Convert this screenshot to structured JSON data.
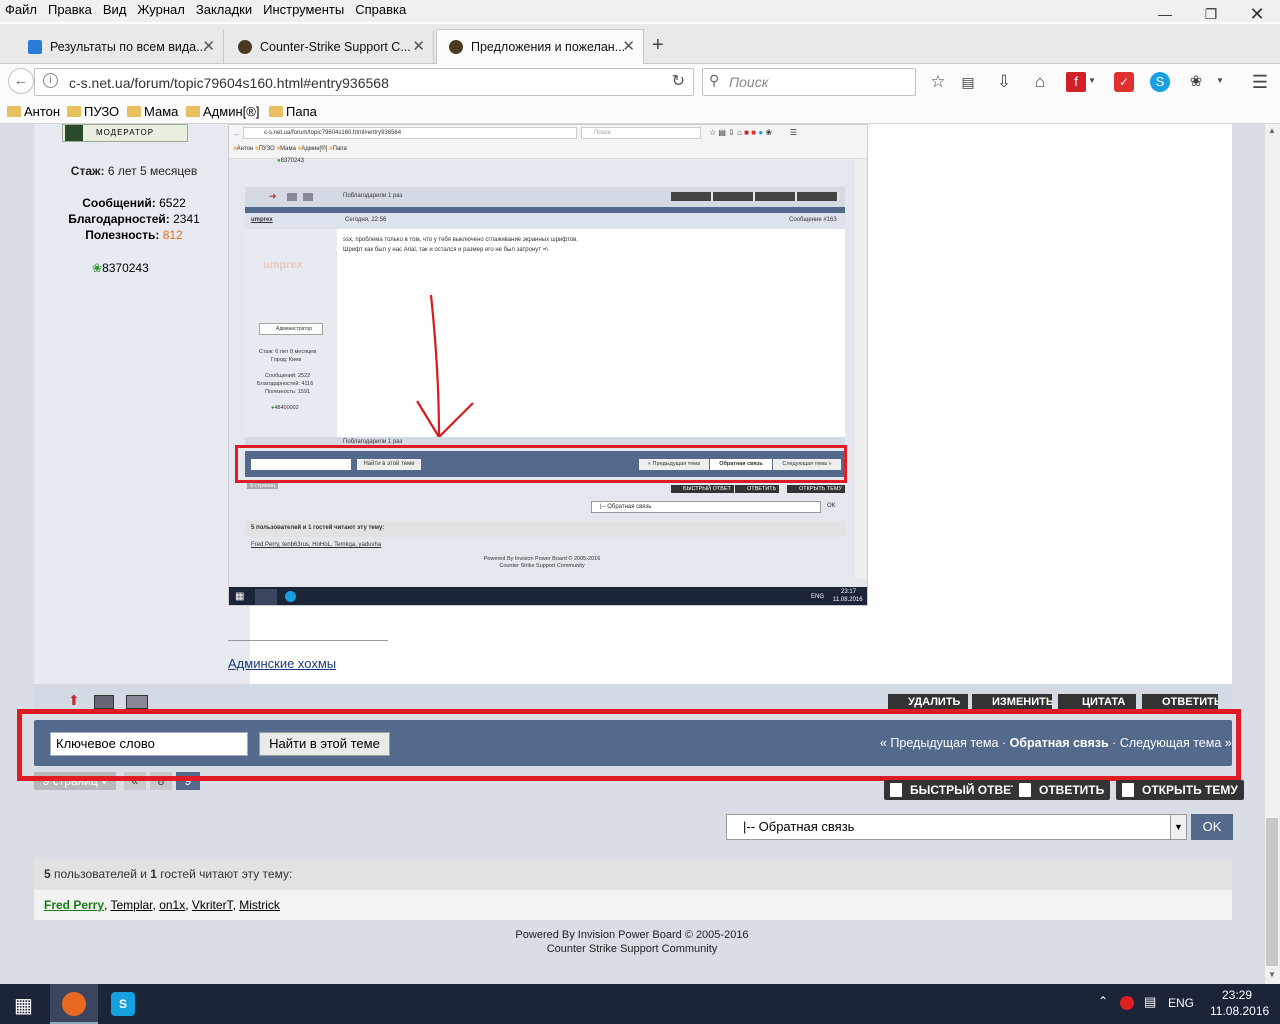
{
  "menu": [
    "Файл",
    "Правка",
    "Вид",
    "Журнал",
    "Закладки",
    "Инструменты",
    "Справка"
  ],
  "tabs": [
    {
      "label": "Результаты по всем вида...",
      "icon": "runner-icon"
    },
    {
      "label": "Counter-Strike Support C...",
      "icon": "cs-icon"
    },
    {
      "label": "Предложения и пожелан...",
      "icon": "cs-icon",
      "active": true
    }
  ],
  "address": {
    "url": "c-s.net.ua/forum/topic79604s160.html#entry936568",
    "search_placeholder": "Поиск"
  },
  "bookmarks": [
    "Антон",
    "ПУЗО",
    "Мама",
    "Админ[®]",
    "Папа"
  ],
  "user": {
    "badge": "МОДЕРАТОР",
    "stazh_label": "Стаж:",
    "stazh_value": "6 лет 5 месяцев",
    "msgs_label": "Сообщений:",
    "msgs_value": "6522",
    "thanks_label": "Благодарностей:",
    "thanks_value": "2341",
    "useful_label": "Полезность:",
    "useful_value": "812",
    "id": "8370243"
  },
  "shot": {
    "url": "c-s.net.ua/forum/topic79604s160.html#entry936564",
    "search": "Поиск",
    "bookmarks": [
      "Антон",
      "ПУЗО",
      "Мама",
      "Админ[®]",
      "Папа"
    ],
    "prev_id": "8370243",
    "thanked": "Поблагодарили 1 раз",
    "author": "umprex",
    "date": "Сегодня, 22:56",
    "msgno": "Сообщение #163",
    "line1": "ssx, проблема только в том, что у тебя выключено сглаживание экранных шрифтов.",
    "line2": "Шрифт как был у нас Arial, так и остался и размер его не был затронут =\\",
    "role": "Администратор",
    "s_stazh": "Стаж: 6 лет 8 месяцев",
    "s_city": "Город: Киев",
    "s_msgs": "Сообщений: 2522",
    "s_thanks": "Благодарностей: 4116",
    "s_useful": "Полезность: 1591",
    "s_id": "48400002",
    "find": "Найти в этой теме",
    "prev": "« Предыдущая тема",
    "feedback": "Обратная связь",
    "next": "Следующая тема »",
    "pages": "9 страниц",
    "b_fast": "БЫСТРЫЙ ОТВЕТ",
    "b_reply": "ОТВЕТИТЬ",
    "b_open": "ОТКРЫТЬ ТЕМУ",
    "select": "|-- Обратная связь",
    "ok": "OK",
    "readers": "5 пользователей и 1 гостей читают эту тему:",
    "readers_list": "Fred Perry, tenb63rus, HoHoL, Temkga, yaduvha",
    "powered": "Powered By Invision Power Board  © 2005-2016",
    "community": "Counter Strike Support Community",
    "lang": "ENG",
    "time": "23:17",
    "date2": "11.08.2016"
  },
  "sig_link": "Админские хохмы",
  "post_buttons": [
    "УДАЛИТЬ",
    "ИЗМЕНИТЬ",
    "ЦИТАТА",
    "ОТВЕТИТЬ"
  ],
  "bar": {
    "keyword": "Ключевое слово",
    "find": "Найти в этой теме",
    "prev": "« Предыдущая тема",
    "sep": "·",
    "feedback": "Обратная связь",
    "next": "Следующая тема »"
  },
  "pagination": {
    "label": "9 страниц ▾",
    "prev": "«",
    "p8": "8",
    "p9": "9"
  },
  "actions": [
    "БЫСТРЫЙ ОТВЕТ",
    "ОТВЕТИТЬ",
    "ОТКРЫТЬ ТЕМУ"
  ],
  "jump": {
    "selected": "|-- Обратная связь",
    "ok": "OK"
  },
  "readers": {
    "count": "5",
    "guests": "1",
    "text_a": " пользователей и ",
    "text_b": " гостей читают эту тему:",
    "users": [
      "Fred Perry",
      "Templar",
      "on1x",
      "VkriterT",
      "Mistrick"
    ]
  },
  "footer": {
    "powered": "Powered By Invision Power Board  © 2005-2016",
    "community": "Counter Strike Support Community"
  },
  "taskbar": {
    "lang": "ENG",
    "time": "23:29",
    "date": "11.08.2016"
  },
  "colors": {
    "bar": "#546a8c",
    "highlight": "#e01b24",
    "useful": "#e07020",
    "link_green": "#1a7a1a"
  }
}
